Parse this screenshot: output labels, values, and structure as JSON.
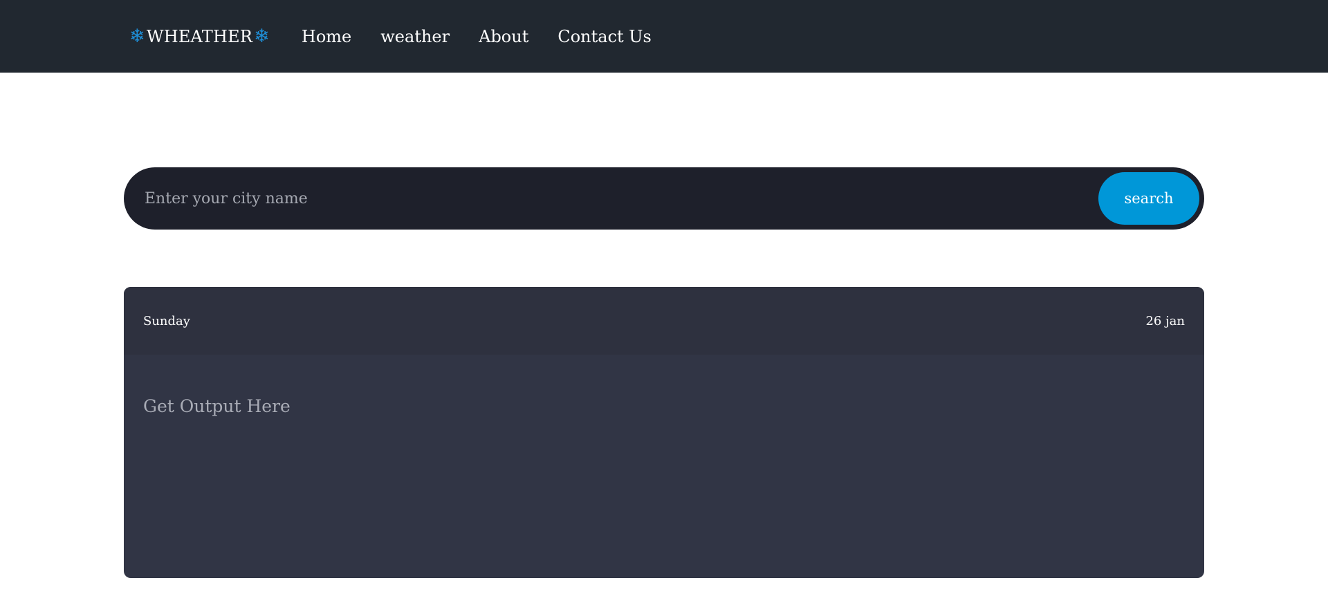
{
  "navbar": {
    "brand": "WHEATHER",
    "links": [
      "Home",
      "weather",
      "About",
      "Contact Us"
    ]
  },
  "search": {
    "placeholder": "Enter your city name",
    "button_label": "search"
  },
  "card": {
    "day": "Sunday",
    "date": "26 jan",
    "output_text": "Get Output Here"
  },
  "colors": {
    "navbar_bg": "#212830",
    "accent": "#0097d8",
    "search_bg": "#1e202b",
    "card_bg": "#313545",
    "card_header_bg": "#2e313f"
  },
  "icons": {
    "brand_icon": "snowflake-icon"
  }
}
